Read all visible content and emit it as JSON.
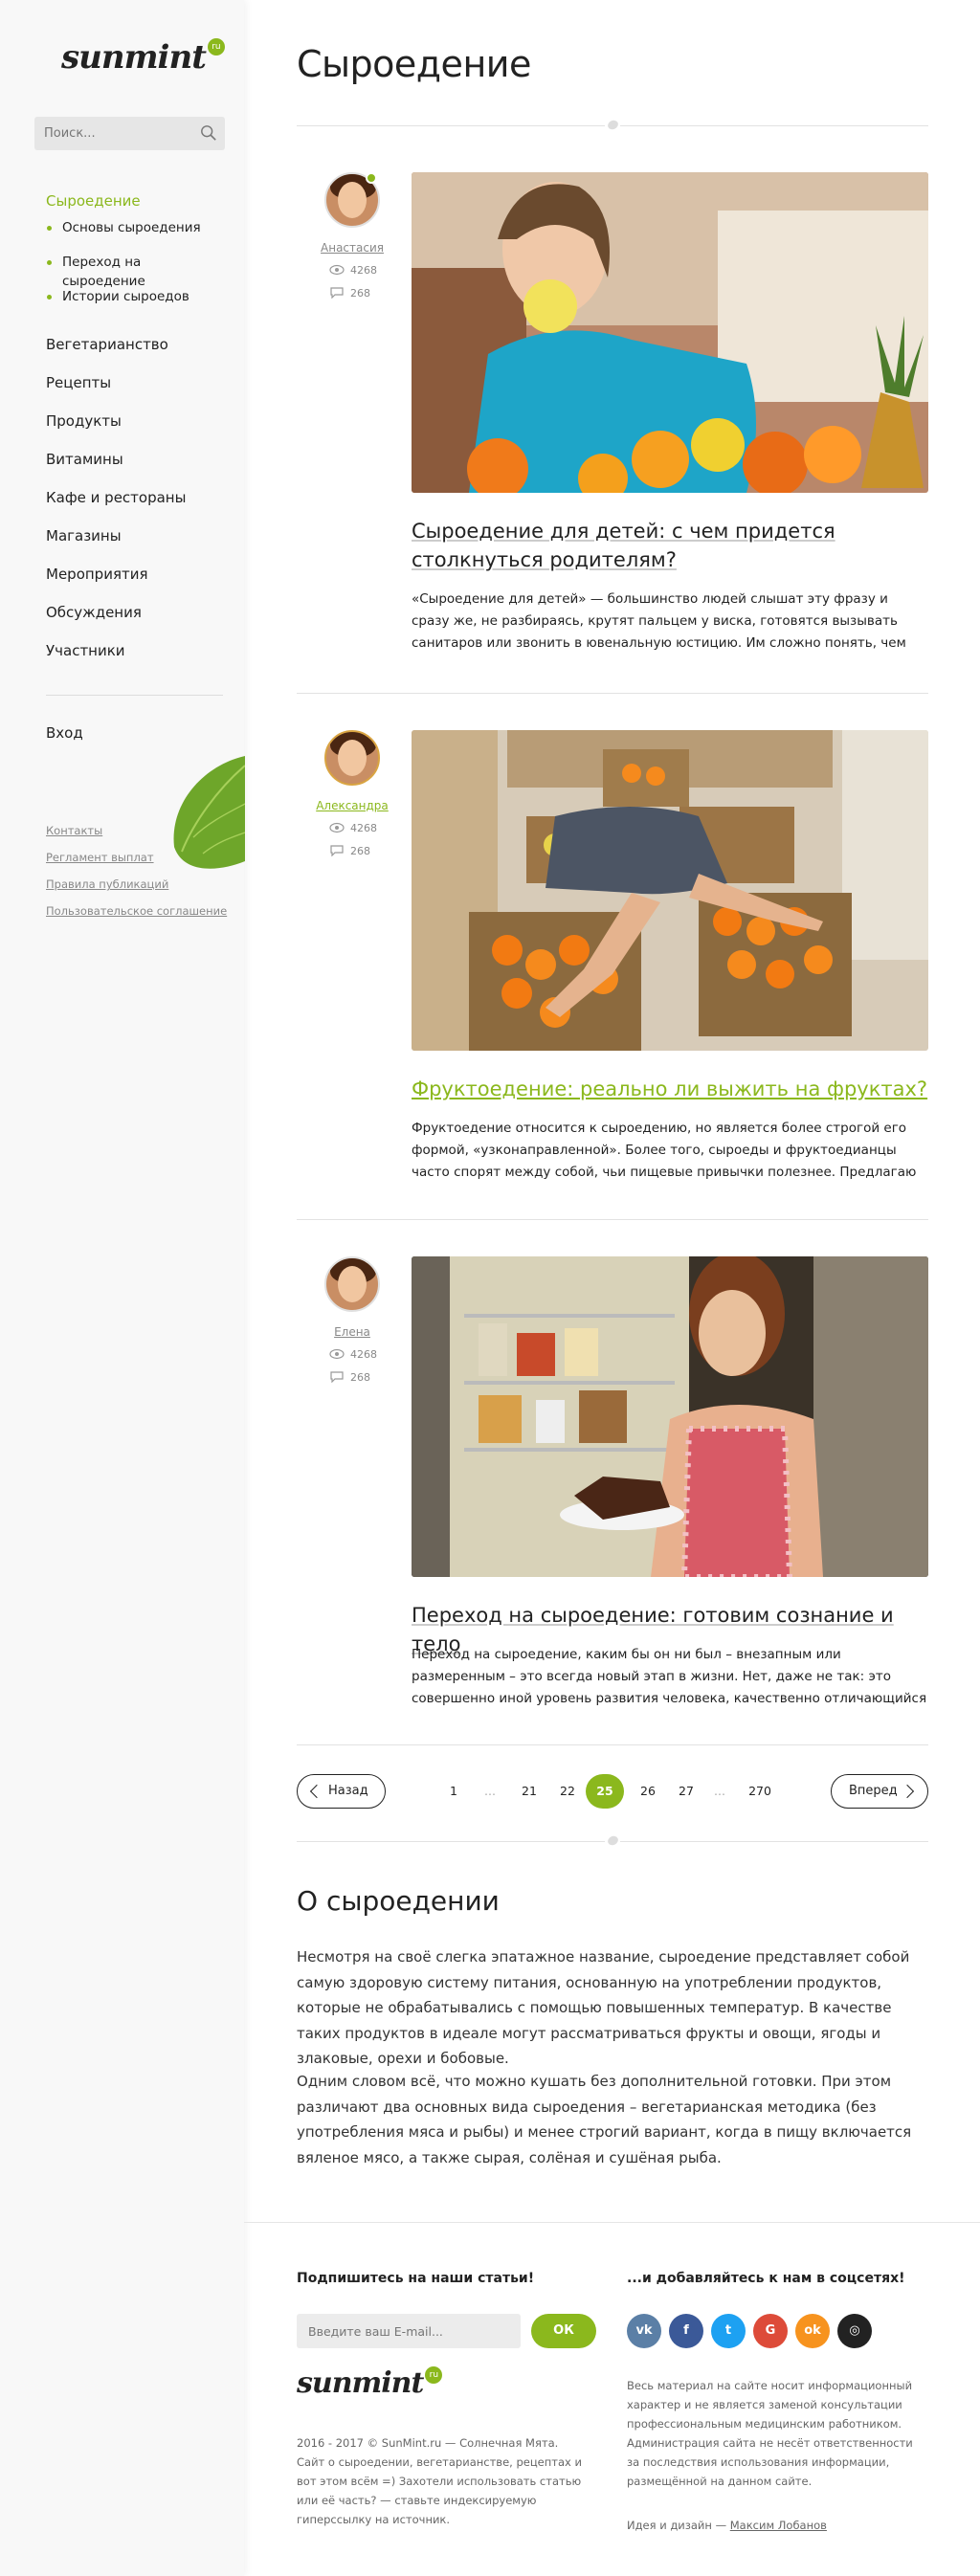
{
  "brand": {
    "logo_text": "sunmint",
    "logo_badge": "ru"
  },
  "search": {
    "placeholder": "Поиск..."
  },
  "sidebar": {
    "active": "Сыроедение",
    "subitems": [
      "Основы сыроедения",
      "Переход на сыроедение",
      "Истории сыроедов"
    ],
    "items": [
      "Вегетарианство",
      "Рецепты",
      "Продукты",
      "Витамины",
      "Кафе и рестораны",
      "Магазины",
      "Мероприятия",
      "Обсуждения",
      "Участники"
    ],
    "login": "Вход",
    "footer_links": [
      "Контакты",
      "Регламент выплат",
      "Правила публикаций",
      "Пользовательское соглашение"
    ]
  },
  "page": {
    "title": "Сыроедение"
  },
  "posts": [
    {
      "author": "Анастасия",
      "views": "4268",
      "comments": "268",
      "title": "Сыроедение для детей: с чем придется столкнуться родителям?",
      "excerpt": "«Сыроедение для детей» — большинство людей слышат эту фразу и сразу же, не разбираясь, крутят пальцем у виска, готовятся вызывать санитаров или звонить в ювенальную юстицию. Им сложно понять, чем руководствуются"
    },
    {
      "author": "Александра",
      "views": "4268",
      "comments": "268",
      "title": "Фруктоедение: реально ли выжить на фруктах?",
      "excerpt": "Фруктоедение относится к сыроедению, но является более строгой его формой, «узконаправленной». Более того, сыроеды и фруктоедианцы часто спорят между собой, чьи пищевые привычки полезнее. Предлагаю узнать о сути этого"
    },
    {
      "author": "Елена",
      "views": "4268",
      "comments": "268",
      "title": "Переход на сыроедение: готовим сознание и тело",
      "excerpt": "Переход на сыроедение, каким бы он ни был – внезапным или размеренным – это всегда новый этап в жизни. Нет, даже не так: это совершенно иной уровень развития человека, качественно отличающийся от всего его предыдущего"
    }
  ],
  "pagination": {
    "prev": "Назад",
    "next": "Вперед",
    "pages": [
      "1",
      "...",
      "21",
      "22",
      "25",
      "26",
      "27",
      "...",
      "270"
    ],
    "current": "25"
  },
  "about": {
    "title": "О сыроедении",
    "p1": "Несмотря на своё слегка эпатажное название, сыроедение представляет собой самую здоровую систему питания, основанную на употреблении продуктов, которые не обрабатывались с помощью повышенных температур. В качестве таких продуктов в идеале могут рассматриваться фрукты и овощи, ягоды и злаковые, орехи и бобовые.",
    "p2": "Одним словом всё, что можно кушать без дополнительной готовки. При этом различают два основных вида сыроедения – вегетарианская методика (без употребления мяса и рыбы) и менее строгий вариант, когда в пищу включается вяленое мясо, а также сырая, солёная и сушёная рыба."
  },
  "footer": {
    "subscribe_title": "Подпишитесь на наши статьи!",
    "email_placeholder": "Введите ваш E-mail...",
    "ok": "ОК",
    "social_title": "...и добавляйтесь к нам в соцсетях!",
    "social": [
      {
        "name": "vk-icon",
        "glyph": "vk",
        "color": "#5b7fa6"
      },
      {
        "name": "facebook-icon",
        "glyph": "f",
        "color": "#3b5998"
      },
      {
        "name": "twitter-icon",
        "glyph": "t",
        "color": "#1da1f2"
      },
      {
        "name": "google-icon",
        "glyph": "G",
        "color": "#dd4b39"
      },
      {
        "name": "odnoklassniki-icon",
        "glyph": "ok",
        "color": "#f7931e"
      },
      {
        "name": "instagram-icon",
        "glyph": "◎",
        "color": "#222222"
      }
    ],
    "copyright": "2016 - 2017 © SunMint.ru — Солнечная Мята. Сайт о сыроедении, вегетарианстве, рецептах и вот этом всём =) Захотели использовать статью или её часть? — ставьте индексируемую гиперссылку на источник.",
    "disclaimer": "Весь материал на сайте носит информационный характер и не является заменой консультации профессиональным медицинским работником. Администрация сайта не несёт ответственности за последствия использования информации, размещённой на данном сайте.",
    "credit_prefix": "Идея и дизайн —",
    "credit_name": "Максим Лобанов"
  },
  "colors": {
    "accent": "#8bb81d",
    "text": "#222222",
    "muted": "#888888"
  }
}
